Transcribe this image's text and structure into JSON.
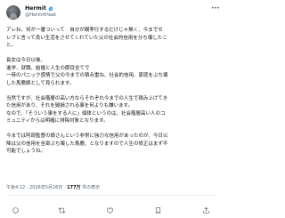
{
  "author": {
    "display_name": "Hermit",
    "handle": "@HermitHaat",
    "avatar_icon": "profile-avatar",
    "verified_icon": "verified-badge-icon",
    "verified_color": "#1d9bf0"
  },
  "more_icon": "more-options-icon",
  "post": {
    "paragraphs": [
      [
        "アレね、何が一番ついって　自分が親孝行するだけじゃ無く、今までセ",
        "レブと言って良い生活をさせてくれていた父の社会的信用を分ち壊したこ",
        "と。"
      ],
      [
        "長女は今日以後、",
        "進学、就職、結婚と人生の節目全てで",
        "一時のパニック感情で父の今までの積み重ね、社会的信用、家庭をぶち壊",
        "した馬鹿娘として見られます。"
      ],
      [
        "当然ですが、社会階層の高い方ならそれぞれ今までの人生で積み上げてき",
        "た信用があり、それを毀損される事を何よりも嫌います。",
        "なので、「そういう事をする人に」個体というのは、社会階層高い人のコ",
        "ミュニティからは明確に排除対象となります。"
      ],
      [
        "今までは阿部監督の娘さんという非常に強力な信用があったのが、今日以",
        "降は父の信用を全部ぶち壊した馬鹿、となりますので人生の修正はまず不",
        "可能でしょうね。"
      ]
    ],
    "time": "午後4:12",
    "date": "2026年5月26日",
    "separator": "·",
    "views_count": "177万",
    "views_label": "件の表示"
  },
  "actions": [
    {
      "name": "reply-icon"
    },
    {
      "name": "repost-icon"
    },
    {
      "name": "like-icon"
    },
    {
      "name": "bookmark-icon"
    },
    {
      "name": "share-icon"
    }
  ],
  "colors": {
    "text": "#0f1419",
    "secondary": "#536471",
    "divider": "#eff3f4",
    "verified": "#1d9bf0"
  }
}
